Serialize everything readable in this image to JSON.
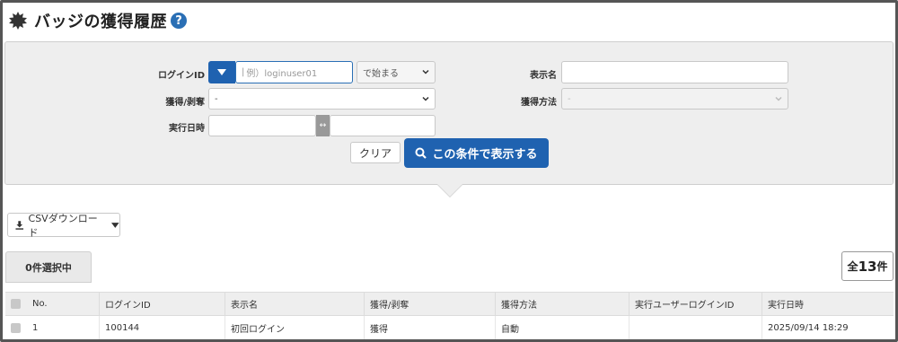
{
  "header": {
    "title": "バッジの獲得履歴",
    "help_glyph": "?"
  },
  "filters": {
    "login_id_label": "ログインID",
    "login_id_placeholder": "例）loginuser01",
    "match_mode": "で始まる",
    "display_name_label": "表示名",
    "display_name_value": "",
    "earn_revoke_label": "獲得/剥奪",
    "earn_revoke_value": "-",
    "earn_method_label": "獲得方法",
    "earn_method_value": "-",
    "exec_datetime_label": "実行日時",
    "swap_glyph": "↔"
  },
  "actions": {
    "clear_label": "クリア",
    "search_label": "この条件で表示する",
    "csv_label": "CSVダウンロード"
  },
  "selection": {
    "selected_label": "0件選択中",
    "total_prefix": "全",
    "total_count": "13",
    "total_suffix": "件"
  },
  "table": {
    "columns": [
      "No.",
      "ログインID",
      "表示名",
      "獲得/剥奪",
      "獲得方法",
      "実行ユーザーログインID",
      "実行日時"
    ],
    "rows": [
      {
        "no": "1",
        "login_id": "100144",
        "display_name": "初回ログイン",
        "earn_revoke": "獲得",
        "method": "自動",
        "exec_user": "",
        "exec_at": "2025/09/14 18:29"
      }
    ]
  },
  "colors": {
    "primary": "#1f62b0",
    "panel_bg": "#eeeeee",
    "help": "#2a6fb5"
  }
}
